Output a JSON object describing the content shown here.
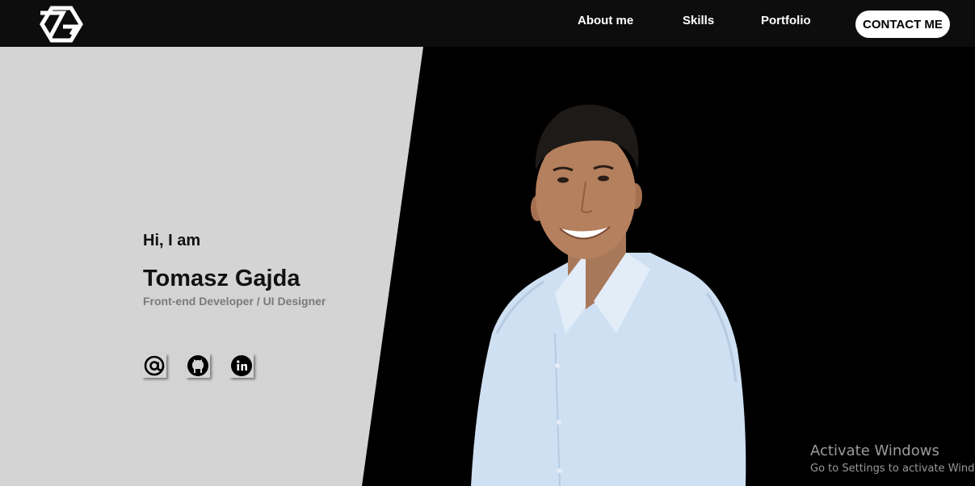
{
  "nav": {
    "logo_icon": "tg-monogram-logo",
    "links": [
      {
        "label": "About me"
      },
      {
        "label": "Skills"
      },
      {
        "label": "Portfolio"
      }
    ],
    "contact_label": "CONTACT ME"
  },
  "hero": {
    "greeting": "Hi, I am",
    "name": "Tomasz Gajda",
    "role": "Front-end Developer / UI Designer",
    "socials": [
      {
        "icon": "at-sign-icon"
      },
      {
        "icon": "github-icon"
      },
      {
        "icon": "linkedin-icon"
      }
    ],
    "photo": "portrait-photo"
  },
  "watermark": {
    "title": "Activate Windows",
    "subtitle": "Go to Settings to activate Windows."
  },
  "colors": {
    "nav_bg": "#0d0d0d",
    "left_panel_bg": "#d4d4d4",
    "right_panel_bg": "#000000",
    "role_text": "#7a7a7a",
    "shirt": "#cfe0f3"
  }
}
